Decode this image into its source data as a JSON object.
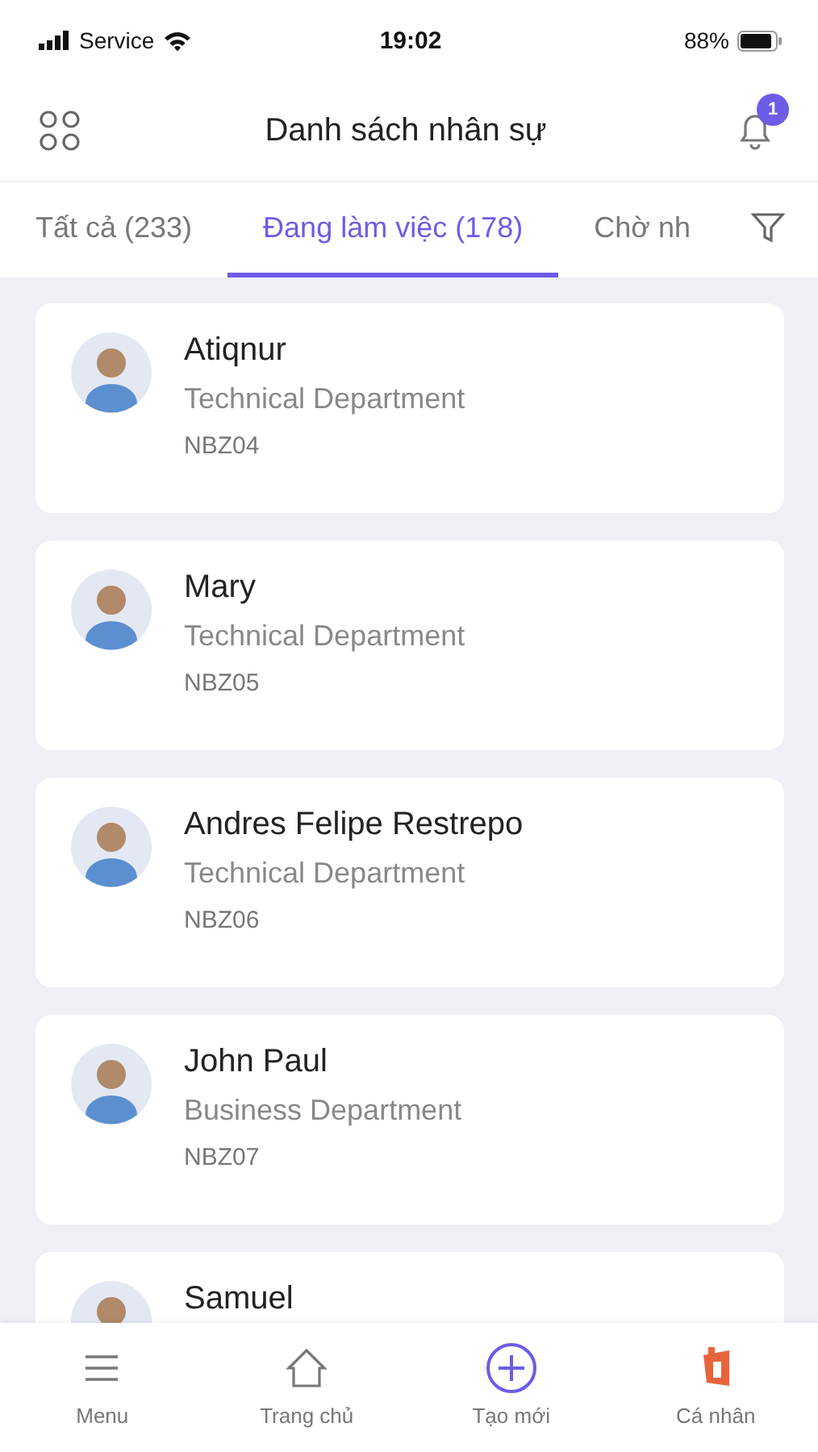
{
  "status_bar": {
    "carrier": "Service",
    "time": "19:02",
    "battery": "88%"
  },
  "header": {
    "title": "Danh sách nhân sự",
    "notification_badge": "1"
  },
  "tabs": [
    {
      "label": "Tất cả (233)",
      "selected": false
    },
    {
      "label": "Đang làm việc (178)",
      "selected": true
    },
    {
      "label": "Chờ nh",
      "selected": false
    }
  ],
  "employees": [
    {
      "name": "Atiqnur",
      "department": "Technical Department",
      "code": "NBZ04"
    },
    {
      "name": "Mary",
      "department": "Technical Department",
      "code": "NBZ05"
    },
    {
      "name": "Andres Felipe Restrepo",
      "department": "Technical Department",
      "code": "NBZ06"
    },
    {
      "name": "John Paul",
      "department": "Business Department",
      "code": "NBZ07"
    },
    {
      "name": "Samuel"
    }
  ],
  "bottom_nav": [
    {
      "kind": "menu",
      "label": "Menu"
    },
    {
      "kind": "home",
      "label": "Trang chủ"
    },
    {
      "kind": "create",
      "label": "Tạo mới"
    },
    {
      "kind": "profile",
      "label": "Cá nhân"
    }
  ]
}
